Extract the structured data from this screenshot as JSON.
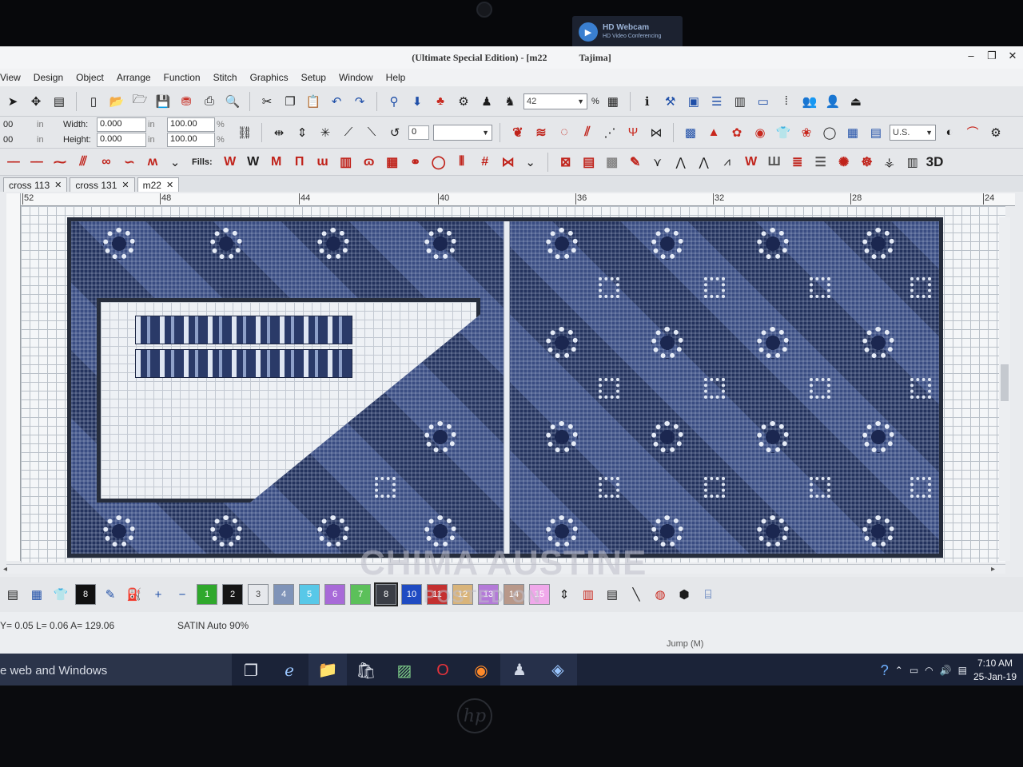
{
  "webcam": {
    "title": "HD Webcam",
    "subtitle": "HD Video Conferencing"
  },
  "window": {
    "title": "(Ultimate Special Edition) - [m22",
    "title_suffix": "Tajima]",
    "controls": [
      "–",
      "❐",
      "✕"
    ]
  },
  "menu": [
    "View",
    "Design",
    "Object",
    "Arrange",
    "Function",
    "Stitch",
    "Graphics",
    "Setup",
    "Window",
    "Help"
  ],
  "dimensions": {
    "row1_prefix": "00",
    "row2_prefix": "00",
    "in_unit": "in",
    "width_label": "Width:",
    "width_value": "0.000",
    "width_unit": "in",
    "width_percent": "100.00",
    "height_label": "Height:",
    "height_value": "0.000",
    "height_unit": "in",
    "height_percent": "100.00",
    "percent_symbol": "%"
  },
  "rotation_field": "0",
  "zoom": {
    "value": "42",
    "unit": "%"
  },
  "units_select": "U.S.",
  "fills_label": "Fills:",
  "three_d_label": "3D",
  "tabs": [
    {
      "label": "cross 113",
      "active": false
    },
    {
      "label": "cross 131",
      "active": false
    },
    {
      "label": "m22",
      "active": true
    }
  ],
  "ruler_ticks": [
    "52",
    "48",
    "44",
    "40",
    "36",
    "32",
    "28",
    "24"
  ],
  "colors": {
    "thread_swatches": [
      {
        "label": "1",
        "color": "#2fa82c"
      },
      {
        "label": "2",
        "color": "#151515"
      },
      {
        "label": "3",
        "color": "#e6e8ec"
      },
      {
        "label": "4",
        "color": "#7f93b8"
      },
      {
        "label": "5",
        "color": "#58c8e8"
      },
      {
        "label": "6",
        "color": "#a86ad8"
      },
      {
        "label": "7",
        "color": "#5cc05a"
      },
      {
        "label": "8",
        "color": "#3a3d45"
      },
      {
        "label": "10",
        "color": "#1f4bc2"
      },
      {
        "label": "11",
        "color": "#c43030"
      },
      {
        "label": "12",
        "color": "#d9b47a"
      },
      {
        "label": "13",
        "color": "#b47ad8"
      },
      {
        "label": "14",
        "color": "#b8988a"
      },
      {
        "label": "15",
        "color": "#f0a8ea"
      }
    ],
    "current_color_label": "8"
  },
  "watermark": {
    "line1": "CHIMA AUSTINE",
    "line2": "POSTED ON"
  },
  "status": {
    "coords": "Y=  0.05 L=   0.06 A= 129.06",
    "stitch": "SATIN Auto 90%",
    "mode": "Jump (M)"
  },
  "taskbar": {
    "search_text": "e web and Windows",
    "time": "7:10 AM",
    "date": "25-Jan-19"
  }
}
